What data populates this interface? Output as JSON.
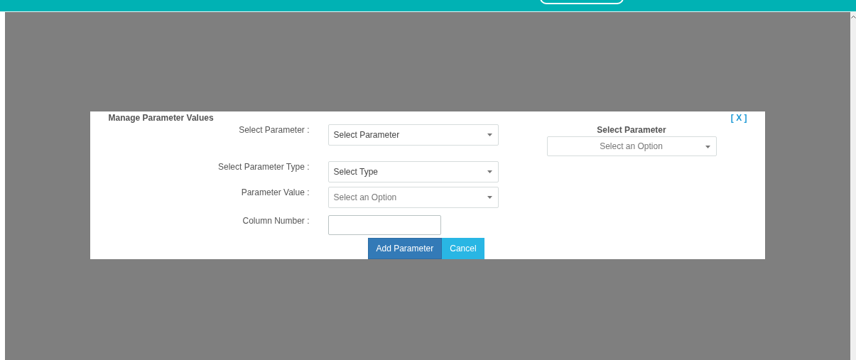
{
  "dialog": {
    "title": "Manage Parameter Values",
    "close": "[ X ]",
    "fields": [
      {
        "kind": "select",
        "label": "Select Parameter :",
        "value": "Select Parameter"
      },
      {
        "kind": "select",
        "label": "Select Parameter Type :",
        "value": "Select Type"
      },
      {
        "kind": "select",
        "label": "Parameter Value :",
        "placeholder": "Select an Option"
      },
      {
        "kind": "text",
        "label": "Column Number :"
      }
    ],
    "buttons": [
      {
        "label": "Add Parameter",
        "kind": "primary"
      },
      {
        "label": "Cancel",
        "kind": "info"
      }
    ],
    "side": {
      "heading": "Select Parameter",
      "placeholder": "Select an Option"
    }
  }
}
